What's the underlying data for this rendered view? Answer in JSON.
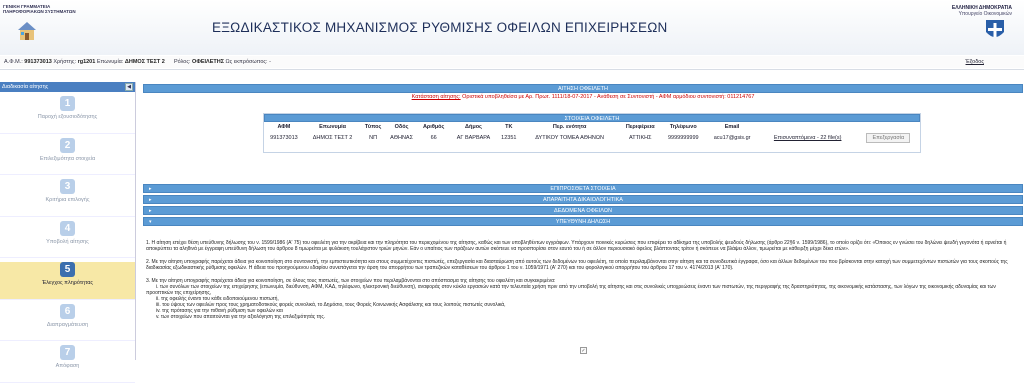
{
  "header": {
    "org_line1": "ΓΕΝΙΚΗ ΓΡΑΜΜΑΤΕΙΑ",
    "org_line2": "ΠΛΗΡΟΦΟΡΙΑΚΩΝ ΣΥΣΤΗΜΑΤΩΝ",
    "title": "ΕΞΩΔΙΚΑΣΤΙΚΟΣ ΜΗΧΑΝΙΣΜΟΣ ΡΥΘΜΙΣΗΣ ΟΦΕΙΛΩΝ ΕΠΙΧΕΙΡΗΣΕΩΝ",
    "ministry_line1": "ΕΛΛΗΝΙΚΗ ΔΗΜΟΚΡΑΤΙΑ",
    "ministry_line2": "Υπουργείο Οικονομικών"
  },
  "userbar": {
    "afm_label": "Α.Φ.Μ.:",
    "afm_value": "991373013",
    "user_label": "Χρήστης:",
    "user_value": "rg1201",
    "name_label": "Επωνυμία:",
    "name_value": "ΔΗΜΟΣ ΤΕΣΤ 2",
    "role_label": "Ρόλος:",
    "role_value": "ΟΦΕΙΛΕΤΗΣ",
    "rep_label": "Ως εκπρόσωπος:",
    "rep_value": "-",
    "exit": "Έξοδος"
  },
  "sidebar": {
    "title": "Διαδικασία αίτησης",
    "steps": [
      {
        "num": "1",
        "label": "Παροχή εξουσιοδότησης"
      },
      {
        "num": "2",
        "label": "Επιλεξιμότητα στοιχεία"
      },
      {
        "num": "3",
        "label": "Κριτήρια επιλογής"
      },
      {
        "num": "4",
        "label": "Υποβολή αίτησης"
      },
      {
        "num": "5",
        "label": "Έλεγχος πληρότητας"
      },
      {
        "num": "6",
        "label": "Διαπραγμάτευση"
      },
      {
        "num": "7",
        "label": "Απόφαση"
      }
    ]
  },
  "application": {
    "title": "ΑΙΤΗΣΗ ΟΦΕΙΛΕΤΗ",
    "status_label": "Κατάσταση αίτησης:",
    "status_value": "Οριστικά υποβληθείσα με Αρ. Πρωτ. 1111/18-07-2017 - Ανάθεση σε Συντονιστή - ΑΦΜ αρμόδιου συντονιστή: 011214767"
  },
  "debtor": {
    "title": "ΣΤΟΙΧΕΙΑ ΟΦΕΙΛΕΤΗ",
    "columns": [
      "ΑΦΜ",
      "Επωνυμία",
      "Τύπος",
      "Οδός",
      "Αριθμός",
      "Δήμος",
      "ΤΚ",
      "Περ. ενότητα",
      "Περιφέρεια",
      "Τηλέφωνο",
      "Email"
    ],
    "row": [
      "991373013",
      "ΔΗΜΟΣ ΤΕΣΤ 2",
      "ΝΠ",
      "ΑΘΗΝΑΣ",
      "66",
      "ΑΓ ΒΑΡΒΑΡΑ",
      "12351",
      "ΔΥΤΙΚΟΥ ΤΟΜΕΑ ΑΘΗΝΩΝ",
      "ΑΤΤΙΚΗΣ",
      "9999999999",
      "acu17@gsis.gr"
    ],
    "attachments_link": "Επισυναπτόμενα - 22 file(s)",
    "edit_button": "Επεξεργασία"
  },
  "sections": {
    "additional": "ΕΠΙΠΡΟΣΘΕΤΑ ΣΤΟΙΧΕΙΑ",
    "documents": "ΑΠΑΡΑΙΤΗΤΑ ΔΙΚΑΙΟΛΟΓΗΤΙΚΑ",
    "debts": "ΔΕΔΟΜΕΝΑ ΟΦΕΙΛΩΝ",
    "declaration": "ΥΠΕΥΘΥΝΗ ΔΗΛΩΣΗ"
  },
  "declaration": {
    "p1": "1. Η αίτηση επέχει θέση υπεύθυνης δήλωσης του ν. 1599/1986 (Α' 75) του οφειλέτη για την ακρίβεια και την πληρότητα του περιεχομένου της αίτησης, καθώς και των υποβληθέντων εγγράφων. Υπάρχουν ποινικές κυρώσεις που επιφέρει το αδίκημα της υποβολής ψευδούς δήλωσης (άρθρο 22§6 ν. 1599/1986), το οποίο ορίζει ότι: «Όποιος εν γνώσει του δηλώνει ψευδή γεγονότα ή αρνείται ή αποκρύπτει τα αληθινά με έγγραφη υπεύθυνη δήλωση του άρθρου 8 τιμωρείται με φυλάκιση τουλάχιστον τριών μηνών. Εάν ο υπαίτιος των πράξεων αυτών σκόπευε να προσπορίσει στον εαυτό του ή σε άλλον περιουσιακό όφελος βλάπτοντας τρίτον ή σκόπευε να βλάψει άλλον, τιμωρείται με κάθειρξη μέχρι δέκα ετών».",
    "p2": "2. Με την αίτηση υπογραφής παρέχεται άδεια για κοινοποίηση στο συντονιστή, την εμπιστευτικότητα και στους συμμετέχοντες πιστωτές, επεξεργασία και διασταύρωση από αυτούς των δεδομένων του οφειλέτη, τα οποία περιλαμβάνονται στην αίτηση και τα συνοδευτικά έγγραφα, όσο και άλλων δεδομένων του που βρίσκονται στην κατοχή των συμμετεχόντων πιστωτών για τους σκοπούς της διαδικασίας εξωδικαστικής ρύθμισης οφειλών. Η άδεια του προηγούμενου εδαφίου συνεπάγεται την άρση του απορρήτου των τραπεζικών καταθέσεων του άρθρου 1 του ν. 1059/1971 (Α' 270) και του φορολογικού απορρήτου του άρθρου 17 του ν. 4174/2013 (Α' 170).",
    "p3": "3. Με την αίτηση υπογραφής παρέχεται άδεια για κοινοποίηση, σε όλους τους πιστωτές, των στοιχείων που περιλαμβάνονται στο απόσπασμα της αίτησης του οφειλέτη και συγκεκριμένα:",
    "items": [
      "i. των συνόλων των στοιχείων της επιχείρησης (επωνυμία, διεύθυνση, ΑΦΜ, ΚΑΔ, τηλέφωνο, ηλεκτρονική διεύθυνση), αναφοράς στον κύκλο εργασιών κατά την τελευταία χρήση πριν από την υποβολή της αίτησης και στις συνολικές υποχρεώσεις έναντι των πιστωτών, της περιγραφής της δραστηριότητας, της οικονομικής κατάστασης, των λόγων της οικονομικής αδυναμίας και των προοπτικών της επιχείρησης,",
      "ii. της οφειλής έναντι του κάθε ειδοποιούμενου πιστωτή,",
      "iii. του ύψους των οφειλών προς τους χρηματοδοτικούς φορείς συνολικά, το Δημόσιο, τους Φορείς Κοινωνικής Ασφάλισης και τους λοιπούς πιστωτές συνολικά,",
      "iv. της πρότασης για την πιθανή ρύθμιση των οφειλών και",
      "v. των στοιχείων που απαιτούνται για την αξιολόγηση της επιλεξιμότητάς της."
    ],
    "checkbox": "✓"
  }
}
